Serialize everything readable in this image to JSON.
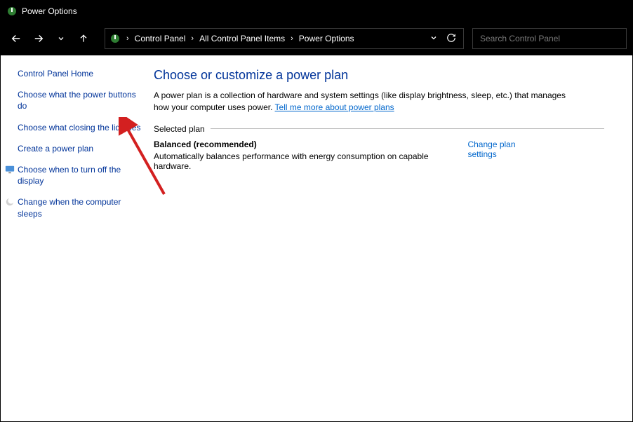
{
  "window": {
    "title": "Power Options"
  },
  "breadcrumb": {
    "items": [
      "Control Panel",
      "All Control Panel Items",
      "Power Options"
    ]
  },
  "search": {
    "placeholder": "Search Control Panel"
  },
  "sidebar": {
    "home": "Control Panel Home",
    "links": [
      {
        "label": "Choose what the power buttons do",
        "icon": null
      },
      {
        "label": "Choose what closing the lid does",
        "icon": null
      },
      {
        "label": "Create a power plan",
        "icon": null
      },
      {
        "label": "Choose when to turn off the display",
        "icon": "monitor"
      },
      {
        "label": "Change when the computer sleeps",
        "icon": "moon"
      }
    ]
  },
  "main": {
    "heading": "Choose or customize a power plan",
    "desc_prefix": "A power plan is a collection of hardware and system settings (like display brightness, sleep, etc.) that manages how your computer uses power. ",
    "desc_link": "Tell me more about power plans",
    "section_label": "Selected plan",
    "plan": {
      "name": "Balanced (recommended)",
      "desc": "Automatically balances performance with energy consumption on capable hardware.",
      "change_link": "Change plan settings"
    }
  }
}
